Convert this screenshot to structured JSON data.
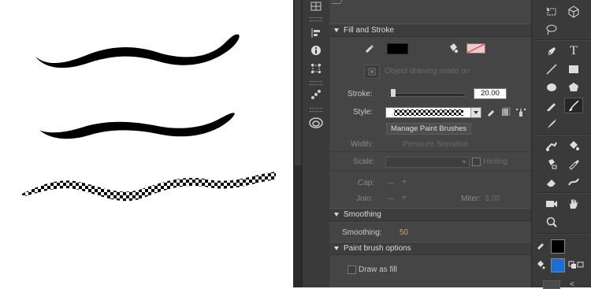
{
  "fill_and_stroke": {
    "header": "Fill and Stroke",
    "object_drawing_mode": "Object drawing mode on",
    "stroke_label": "Stroke:",
    "stroke_value": "20.00",
    "stroke_slider_fraction": 0.05,
    "style_label": "Style:",
    "manage_button": "Manage Paint Brushes",
    "width_label": "Width:",
    "width_value": "Pressure Sensitive",
    "scale_label": "Scale:",
    "hinting_label": "Hinting",
    "cap_label": "Cap:",
    "join_label": "Join:",
    "miter_label": "Miter:",
    "miter_value": "3.00",
    "stroke_color": "#000000",
    "fill_color": "none"
  },
  "smoothing": {
    "header": "Smoothing",
    "label": "Smoothing:",
    "value": "50"
  },
  "paint_brush_options": {
    "header": "Paint brush options",
    "draw_as_fill_label": "Draw as fill",
    "draw_as_fill_checked": false
  },
  "tools": {
    "active_tool": "paint-brush-tool",
    "stroke_color": "#000000",
    "fill_color": "#1a6fd6"
  }
}
